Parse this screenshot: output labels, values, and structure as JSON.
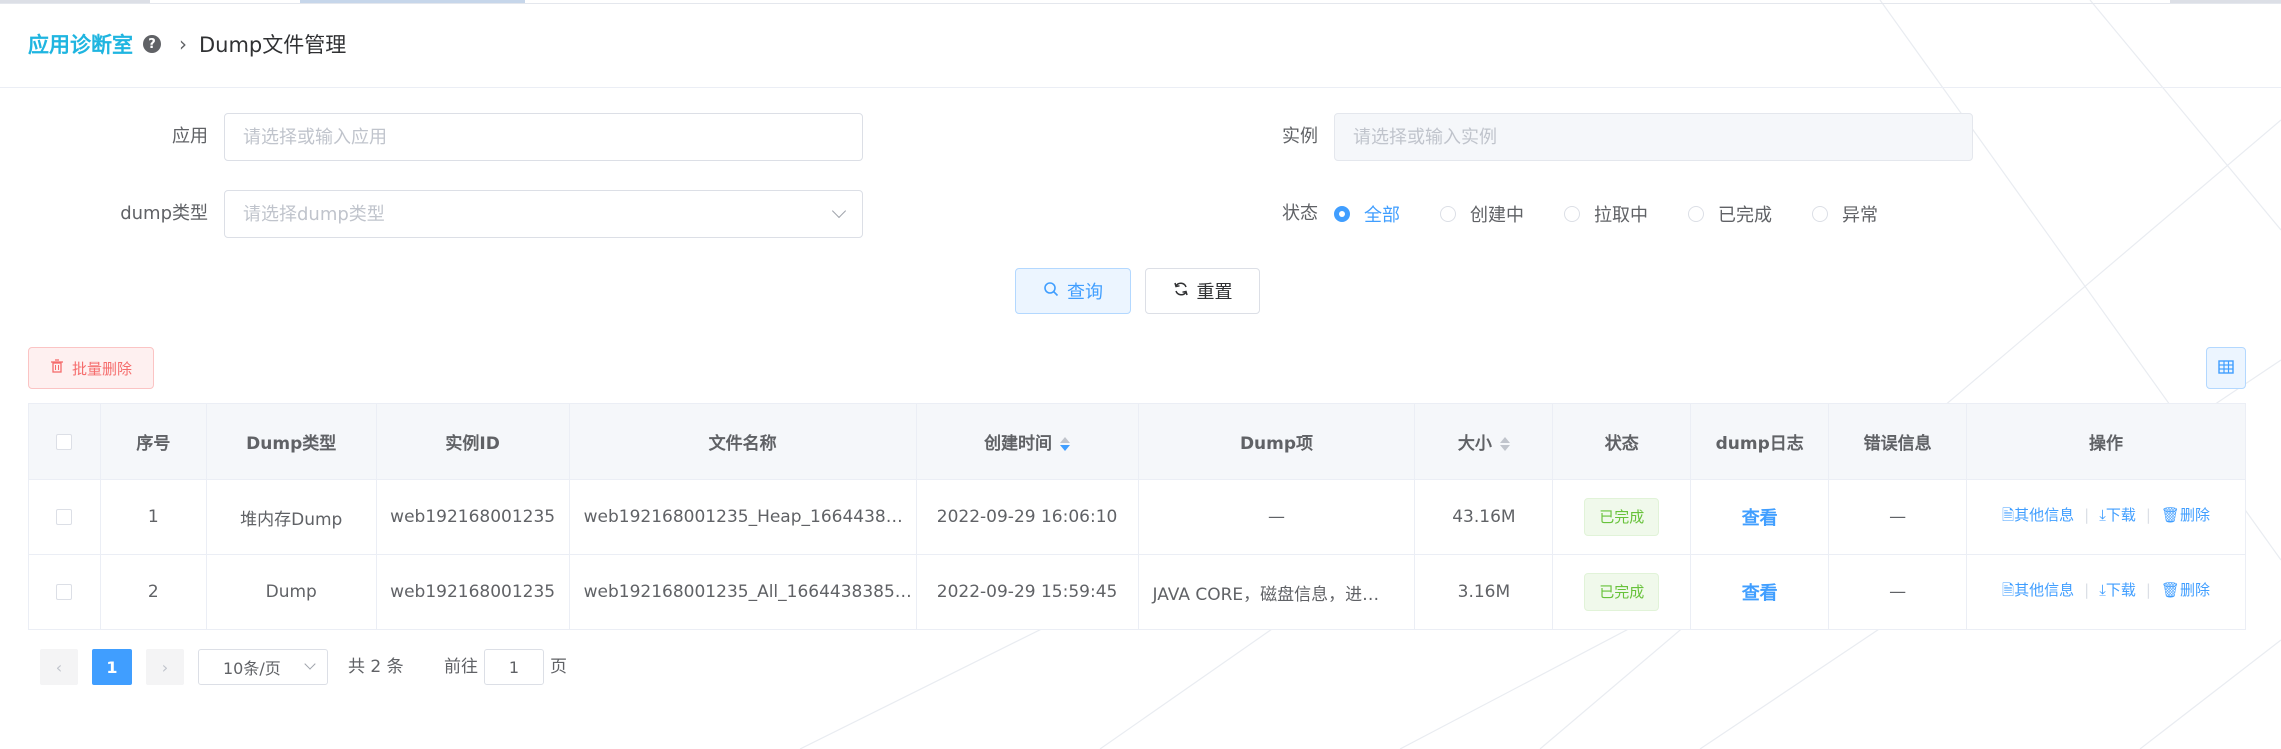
{
  "breadcrumb": {
    "root": "应用诊断室",
    "help_glyph": "?",
    "current": "Dump文件管理"
  },
  "form": {
    "app_label": "应用",
    "app_placeholder": "请选择或输入应用",
    "instance_label": "实例",
    "instance_placeholder": "请选择或输入实例",
    "dump_type_label": "dump类型",
    "dump_type_placeholder": "请选择dump类型",
    "status_label": "状态",
    "status_options": [
      "全部",
      "创建中",
      "拉取中",
      "已完成",
      "异常"
    ],
    "status_selected": "全部",
    "query_label": "查询",
    "reset_label": "重置"
  },
  "toolbar": {
    "batch_delete_label": "批量删除"
  },
  "table": {
    "headers": [
      "序号",
      "Dump类型",
      "实例ID",
      "文件名称",
      "创建时间",
      "Dump项",
      "大小",
      "状态",
      "dump日志",
      "错误信息",
      "操作"
    ],
    "rows": [
      {
        "index": "1",
        "dump_type": "堆内存Dump",
        "instance_id": "web192168001235",
        "file_name": "web192168001235_Heap_1664438…",
        "created_at": "2022-09-29 16:06:10",
        "dump_items": "—",
        "size": "43.16M",
        "status": "已完成",
        "log": "查看",
        "error": "—"
      },
      {
        "index": "2",
        "dump_type": "Dump",
        "instance_id": "web192168001235",
        "file_name": "web192168001235_All_1664438385…",
        "created_at": "2022-09-29 15:59:45",
        "dump_items": "JAVA CORE，磁盘信息，进…",
        "size": "3.16M",
        "status": "已完成",
        "log": "查看",
        "error": "—"
      }
    ],
    "ops": {
      "info": "其他信息",
      "download": "下载",
      "delete": "删除"
    }
  },
  "pagination": {
    "prev": "‹",
    "next": "›",
    "current_page": "1",
    "page_size": "10条/页",
    "total": "共 2 条",
    "jump_prefix": "前往",
    "jump_value": "1",
    "jump_suffix": "页"
  },
  "colors": {
    "primary": "#409eff",
    "brand": "#1fb5e0",
    "success": "#67c23a",
    "danger": "#f56c6c"
  }
}
